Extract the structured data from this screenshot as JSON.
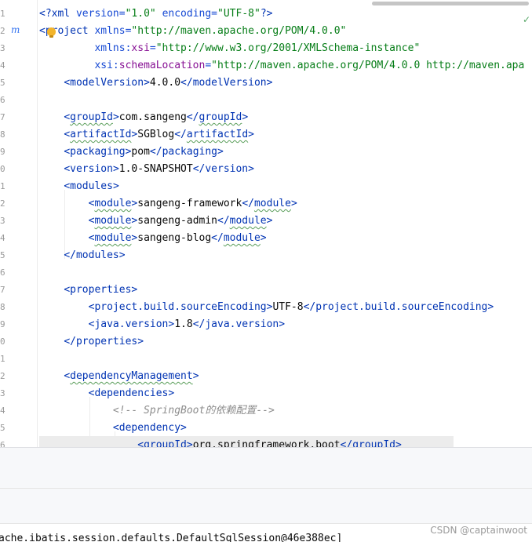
{
  "editor": {
    "line_numbers": [
      "1",
      "2",
      "3",
      "4",
      "5",
      "6",
      "7",
      "8",
      "9",
      "0",
      "1",
      "2",
      "3",
      "4",
      "5",
      "6",
      "7",
      "8",
      "9",
      "0",
      "1",
      "2",
      "3",
      "4",
      "5",
      "6"
    ],
    "gutter_marker": "m",
    "lines": [
      "<?xml version=\"1.0\" encoding=\"UTF-8\"?>",
      "<project xmlns=\"http://maven.apache.org/POM/4.0.0\"",
      "         xmlns:xsi=\"http://www.w3.org/2001/XMLSchema-instance\"",
      "         xsi:schemaLocation=\"http://maven.apache.org/POM/4.0.0 http://maven.apa",
      "    <modelVersion>4.0.0</modelVersion>",
      "",
      "    <groupId>com.sangeng</groupId>",
      "    <artifactId>SGBlog</artifactId>",
      "    <packaging>pom</packaging>",
      "    <version>1.0-SNAPSHOT</version>",
      "    <modules>",
      "        <module>sangeng-framework</module>",
      "        <module>sangeng-admin</module>",
      "        <module>sangeng-blog</module>",
      "    </modules>",
      "",
      "    <properties>",
      "        <project.build.sourceEncoding>UTF-8</project.build.sourceEncoding>",
      "        <java.version>1.8</java.version>",
      "    </properties>",
      "",
      "    <dependencyManagement>",
      "        <dependencies>",
      "            <!-- SpringBoot的依赖配置-->",
      "            <dependency>",
      "                <groupId>org.springframework.boot</groupId>"
    ]
  },
  "console": {
    "text": "ache.ibatis.session.defaults.DefaultSqlSession@46e388ec]"
  },
  "watermark": "CSDN @captainwoot",
  "icons": {
    "inspection_ok": "check-icon",
    "intention_bulb": "lightbulb-icon",
    "maven_marker": "maven-icon"
  }
}
